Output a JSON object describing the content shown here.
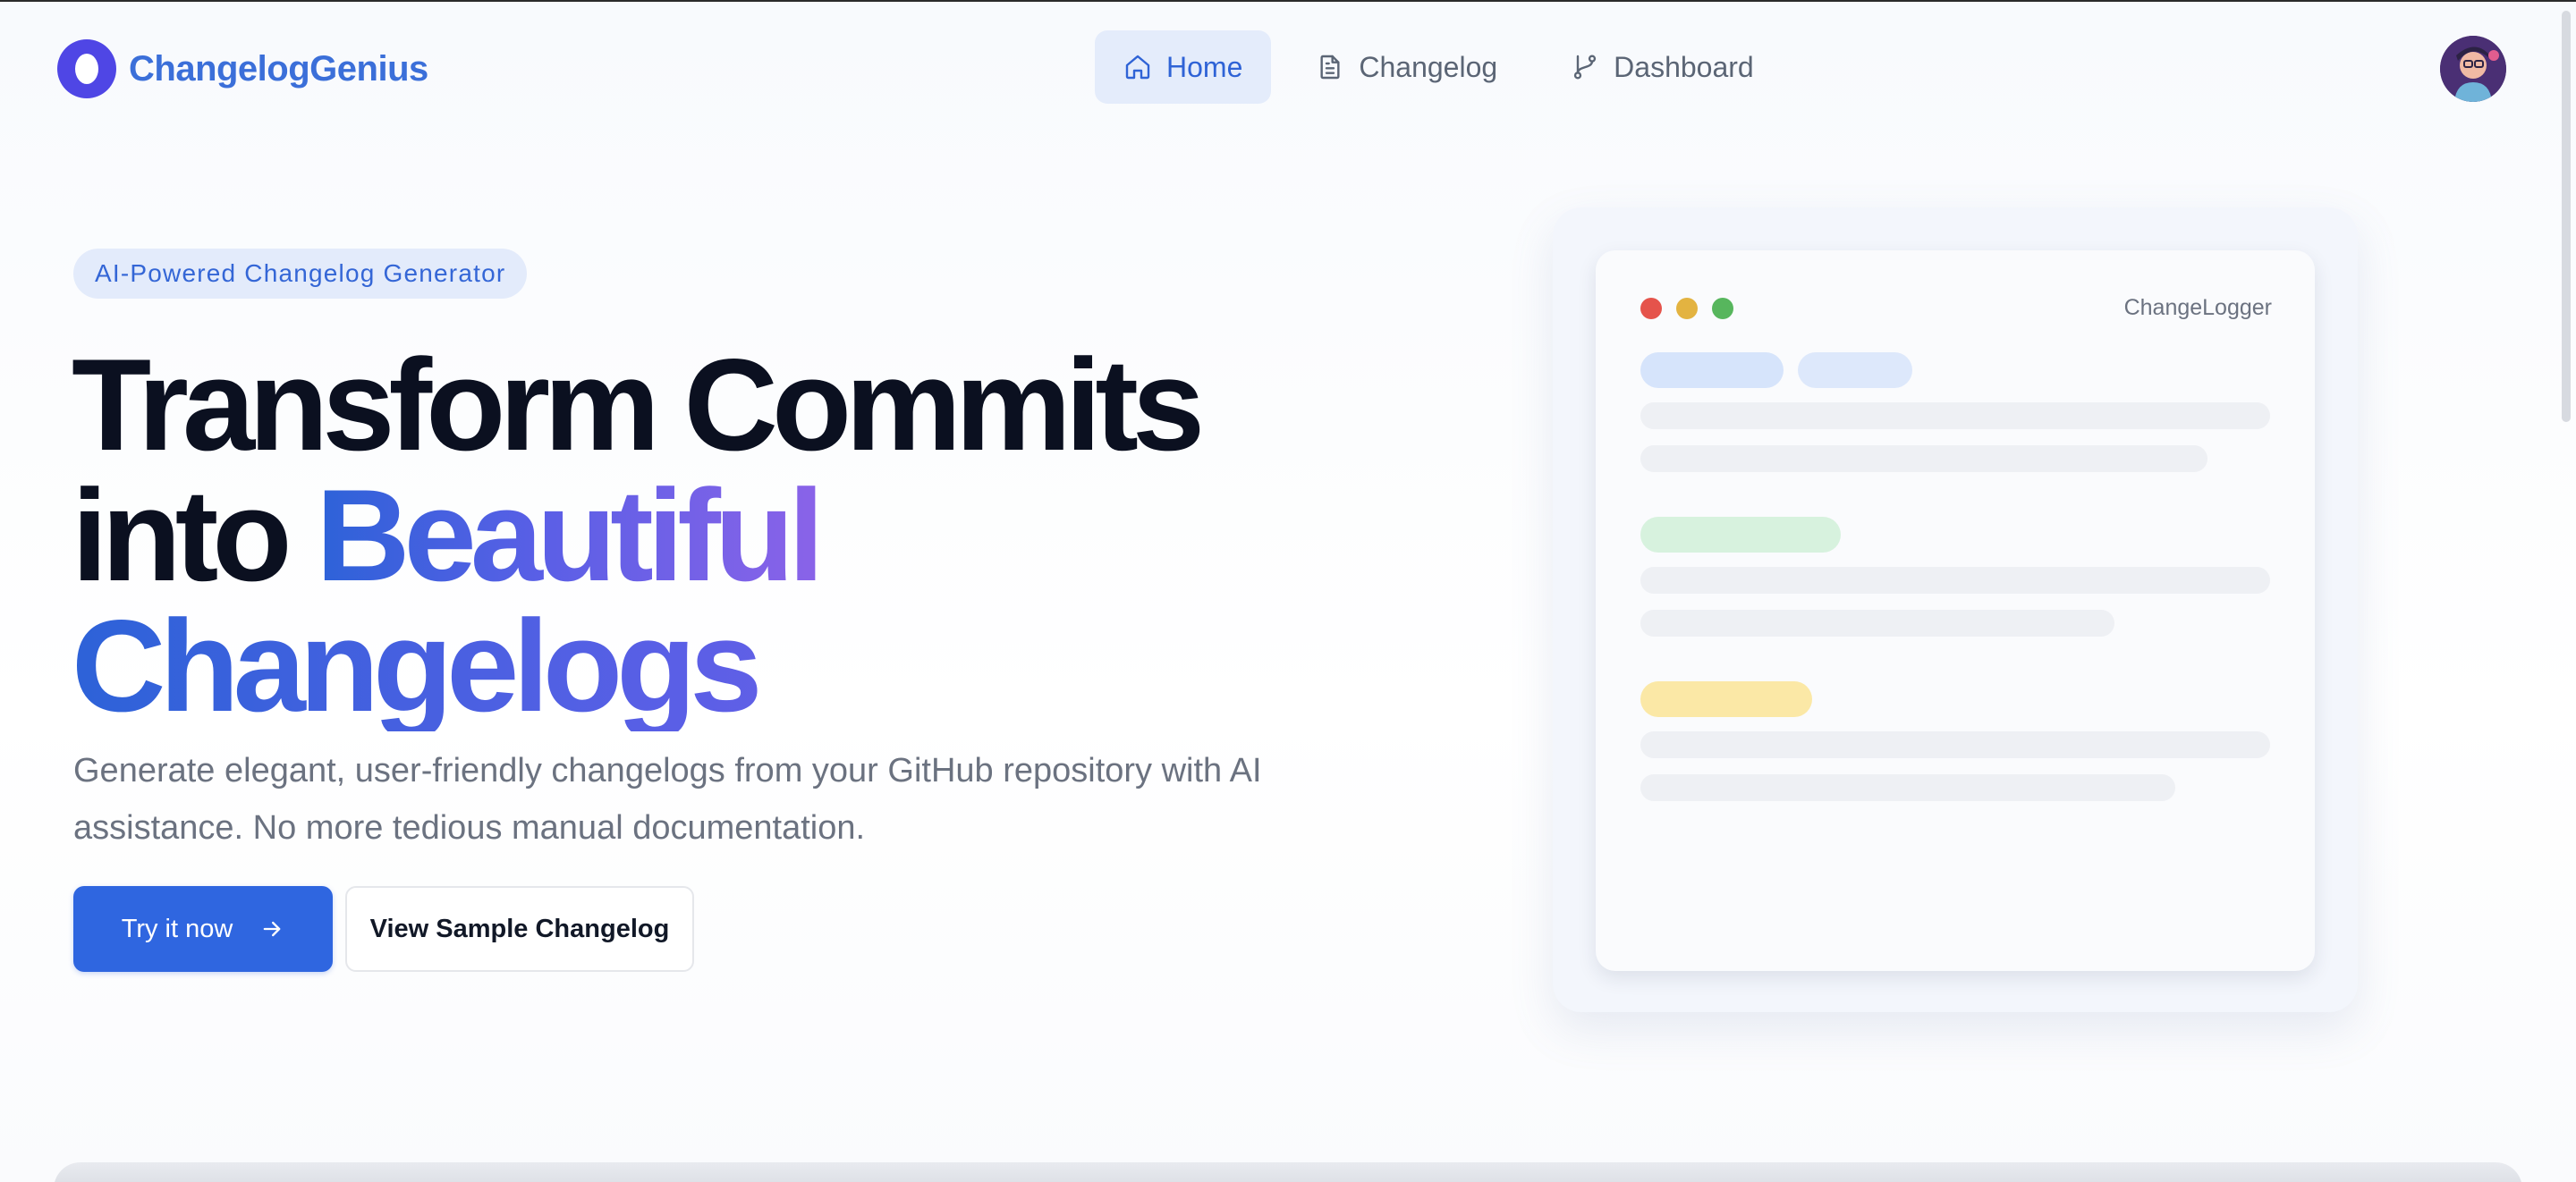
{
  "app": {
    "brand": "ChangelogGenius"
  },
  "nav": {
    "items": [
      {
        "label": "Home",
        "icon": "home-icon",
        "active": true
      },
      {
        "label": "Changelog",
        "icon": "document-icon",
        "active": false
      },
      {
        "label": "Dashboard",
        "icon": "git-branch-icon",
        "active": false
      }
    ]
  },
  "hero": {
    "badge": "AI-Powered Changelog Generator",
    "headline": {
      "line1": "Transform Commits",
      "line2_prefix": "into ",
      "line2_highlight": "Beautiful",
      "line3": "Changelogs"
    },
    "subtitle": "Generate elegant, user-friendly changelogs from your GitHub repository with AI assistance. No more tedious manual documentation.",
    "primary_button": "Try it now",
    "secondary_button": "View Sample Changelog"
  },
  "preview": {
    "window_title": "ChangeLogger",
    "traffic_lights": [
      "#e5534b",
      "#e3b341",
      "#57b65d"
    ],
    "tag_colors": [
      "#d6e4fb",
      "#d7f2de",
      "#fbe8a6"
    ]
  },
  "colors": {
    "accent": "#2f66e0",
    "brand": "#4f46e5",
    "nav_active_bg": "#e4ecfb"
  }
}
